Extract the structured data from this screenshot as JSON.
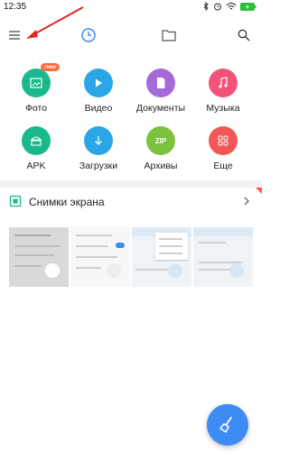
{
  "status": {
    "time": "12:35"
  },
  "toolbar": {
    "menu_icon": "hamburger-menu-icon",
    "recent_icon": "clock-icon",
    "folder_icon": "folder-icon",
    "search_icon": "search-icon"
  },
  "categories": [
    {
      "label": "Фото",
      "icon": "photo-icon",
      "color": "#19b98b",
      "badge": "new"
    },
    {
      "label": "Видео",
      "icon": "play-icon",
      "color": "#2aa6e6"
    },
    {
      "label": "Документы",
      "icon": "document-icon",
      "color": "#a56ad8"
    },
    {
      "label": "Музыка",
      "icon": "music-note-icon",
      "color": "#f2537a"
    },
    {
      "label": "APK",
      "icon": "android-icon",
      "color": "#19b98b"
    },
    {
      "label": "Загрузки",
      "icon": "download-icon",
      "color": "#2aa6e6"
    },
    {
      "label": "Архивы",
      "icon": "zip-icon",
      "color": "#7cc23e",
      "icon_text": "ZIP"
    },
    {
      "label": "Еще",
      "icon": "grid-more-icon",
      "color": "#f25757"
    }
  ],
  "section": {
    "title": "Снимки экрана",
    "icon": "screenshot-icon",
    "chevron_icon": "chevron-right-icon"
  },
  "fab": {
    "icon": "broom-clean-icon",
    "color": "#3d8bf5"
  },
  "annotation": {
    "icon": "red-arrow-icon",
    "color": "#e0261f"
  }
}
